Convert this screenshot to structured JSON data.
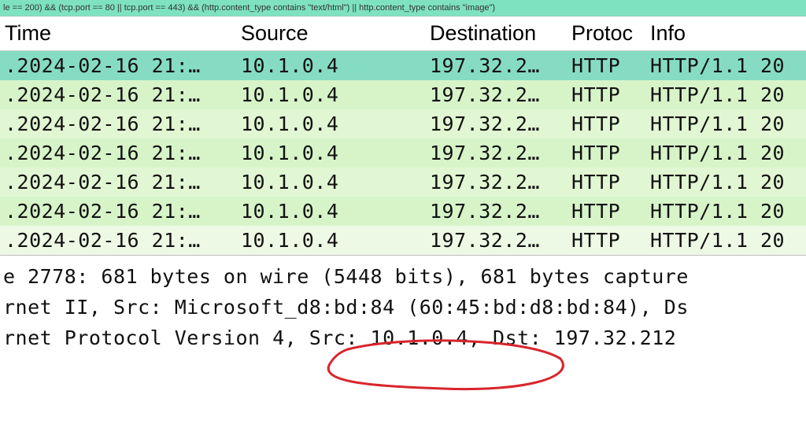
{
  "filter": "le == 200) && (tcp.port == 80 || tcp.port == 443) && (http.content_type contains \"text/html\") || http.content_type contains \"image\")",
  "headers": {
    "time": "Time",
    "source": "Source",
    "destination": "Destination",
    "protocol": "Protoc",
    "info": "Info"
  },
  "rows": [
    {
      "time": ".2024-02-16 21:…",
      "source": "10.1.0.4",
      "destination": "197.32.2…",
      "protocol": "HTTP",
      "info": "HTTP/1.1 20"
    },
    {
      "time": ".2024-02-16 21:…",
      "source": "10.1.0.4",
      "destination": "197.32.2…",
      "protocol": "HTTP",
      "info": "HTTP/1.1 20"
    },
    {
      "time": ".2024-02-16 21:…",
      "source": "10.1.0.4",
      "destination": "197.32.2…",
      "protocol": "HTTP",
      "info": "HTTP/1.1 20"
    },
    {
      "time": ".2024-02-16 21:…",
      "source": "10.1.0.4",
      "destination": "197.32.2…",
      "protocol": "HTTP",
      "info": "HTTP/1.1 20"
    },
    {
      "time": ".2024-02-16 21:…",
      "source": "10.1.0.4",
      "destination": "197.32.2…",
      "protocol": "HTTP",
      "info": "HTTP/1.1 20"
    },
    {
      "time": ".2024-02-16 21:…",
      "source": "10.1.0.4",
      "destination": "197.32.2…",
      "protocol": "HTTP",
      "info": "HTTP/1.1 20"
    },
    {
      "time": ".2024-02-16 21:…",
      "source": "10.1.0.4",
      "destination": "197.32.2…",
      "protocol": "HTTP",
      "info": "HTTP/1.1 20"
    }
  ],
  "details": {
    "frame": "e 2778: 681 bytes on wire (5448 bits), 681 bytes capture",
    "eth": "rnet II, Src: Microsoft_d8:bd:84 (60:45:bd:d8:bd:84), Ds",
    "ip": "rnet Protocol Version 4, Src: 10.1.0.4, Dst: 197.32.212"
  }
}
